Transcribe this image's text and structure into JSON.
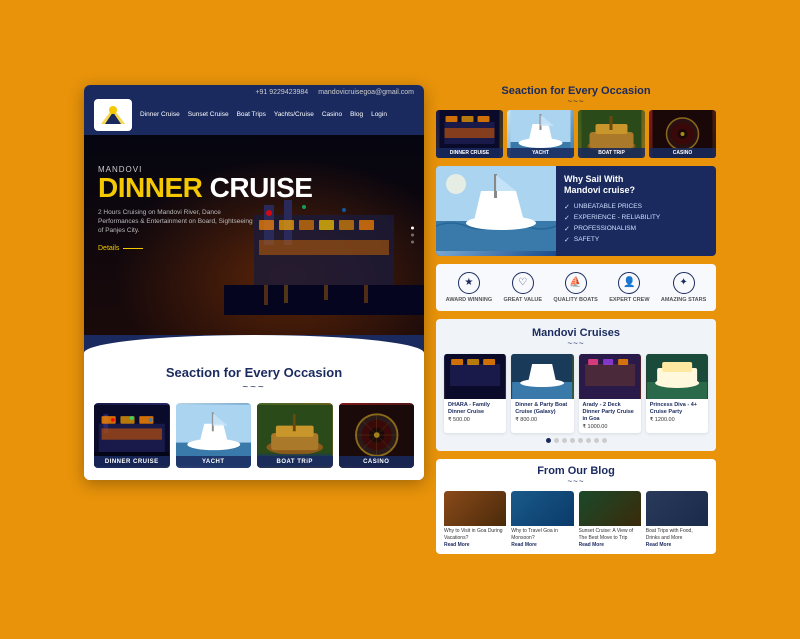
{
  "brand": {
    "name": "MANDOVI",
    "phone": "+91 9229423984",
    "email": "mandovicruisegoa@gmail.com"
  },
  "nav": {
    "links": [
      "Dinner Cruise",
      "Sunset Cruise",
      "Boat Trips",
      "Yachts/Cruise",
      "Casino",
      "Blog",
      "Login"
    ]
  },
  "hero": {
    "sub": "MANDOVI",
    "title_yellow": "DINNER",
    "title_white": "CRUISE",
    "description": "2 Hours Cruising on Mandovi River, Dance Performances & Entertainment on Board, Sightseeing of Panjes City.",
    "button": "Details"
  },
  "section_occasion": {
    "title": "Seaction for Every Occasion",
    "wave": "~~~",
    "cards": [
      {
        "label": "DINNER CRUISE",
        "type": "dinner"
      },
      {
        "label": "YACHT",
        "type": "yacht"
      },
      {
        "label": "BOAT TRiP",
        "type": "boat"
      },
      {
        "label": "CASINO",
        "type": "casino"
      }
    ]
  },
  "why_sail": {
    "title": "Why Sail With\nMandovi cruise?",
    "points": [
      "UNBEATABLE PRICES",
      "EXPERIENCE - RELIABILITY",
      "PROFESSIONALISM",
      "SAFETY"
    ]
  },
  "badges": [
    {
      "icon": "★",
      "label": "AWARD WINNING"
    },
    {
      "icon": "♡",
      "label": "GREAT VALUE"
    },
    {
      "icon": "◈",
      "label": "QUALITY BOATS"
    },
    {
      "icon": "⛵",
      "label": "EXPERT CREW"
    },
    {
      "icon": "✦",
      "label": "AMAZING STARS"
    }
  ],
  "mandovi_cruises": {
    "title": "Mandovi Cruises",
    "wave": "~~~",
    "cards": [
      {
        "title": "DHARA - Family Dinner Cruise",
        "price": "₹ 500.00",
        "type": "c1"
      },
      {
        "title": "Dinner & Party Boat Cruise (Galaxy)",
        "price": "₹ 800.00",
        "type": "c2"
      },
      {
        "title": "Arady - 2 Deck Dinner Party Cruise in Goa",
        "price": "₹ 1000.00",
        "type": "c3"
      },
      {
        "title": "Princess Diva - 4+ Cruise Party",
        "price": "₹ 1200.00",
        "type": "c4"
      }
    ],
    "dots": [
      true,
      false,
      false,
      false,
      false,
      false,
      false,
      false
    ]
  },
  "blog": {
    "title": "From Our Blog",
    "wave": "~~~",
    "posts": [
      {
        "title": "Why to Visit in Goa During Vacations?",
        "read": "Read More"
      },
      {
        "title": "Why to Travel Goa in Monsoon?",
        "read": "Read More"
      },
      {
        "title": "Sunset Cruise: A View of The Best Move to Trip",
        "read": "Read More"
      },
      {
        "title": "Boat Trips with Food, Drinks and More",
        "read": "Read More"
      }
    ]
  }
}
